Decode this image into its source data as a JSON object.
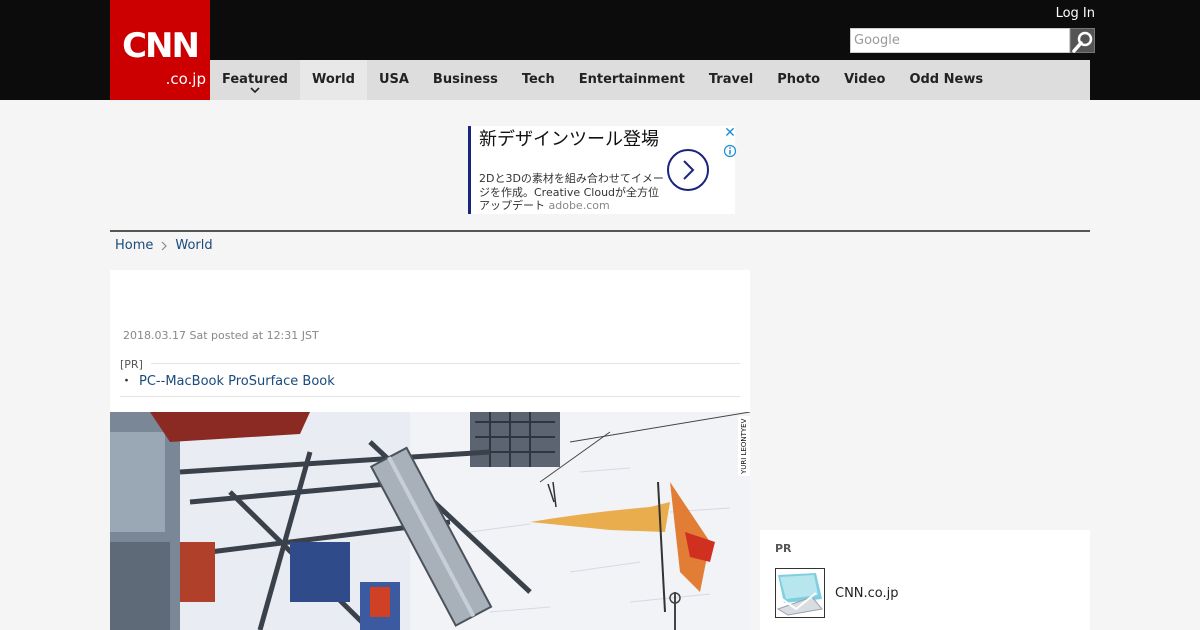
{
  "header": {
    "logo_main": "CNN",
    "logo_sub": ".co.jp",
    "login_label": "Log In",
    "search_placeholder": "Google"
  },
  "nav": {
    "items": [
      {
        "label": "Featured"
      },
      {
        "label": "World"
      },
      {
        "label": "USA"
      },
      {
        "label": "Business"
      },
      {
        "label": "Tech"
      },
      {
        "label": "Entertainment"
      },
      {
        "label": "Travel"
      },
      {
        "label": "Photo"
      },
      {
        "label": "Video"
      },
      {
        "label": "Odd News"
      }
    ]
  },
  "ad": {
    "title": "新デザインツール登場",
    "body": "2Dと3Dの素材を組み合わせてイメージを作成。Creative Cloudが全方位アップデート",
    "domain": "adobe.com"
  },
  "breadcrumb": {
    "home": "Home",
    "section": "World"
  },
  "article": {
    "posted": "2018.03.17 Sat posted at 12:31 JST",
    "pr_label": "[PR]",
    "pr_bullet": "・",
    "pr_link": "PC--MacBook ProSurface Book",
    "photo_credit": "YURI LEONTYEV"
  },
  "sidebar_pr": {
    "label": "PR",
    "site": "CNN.co.jp"
  },
  "colors": {
    "brand_red": "#cc0000",
    "header_bg": "#0c0c0c",
    "nav_bg": "#dddddd",
    "link": "#1a4a7a",
    "ad_accent": "#1a237e"
  }
}
